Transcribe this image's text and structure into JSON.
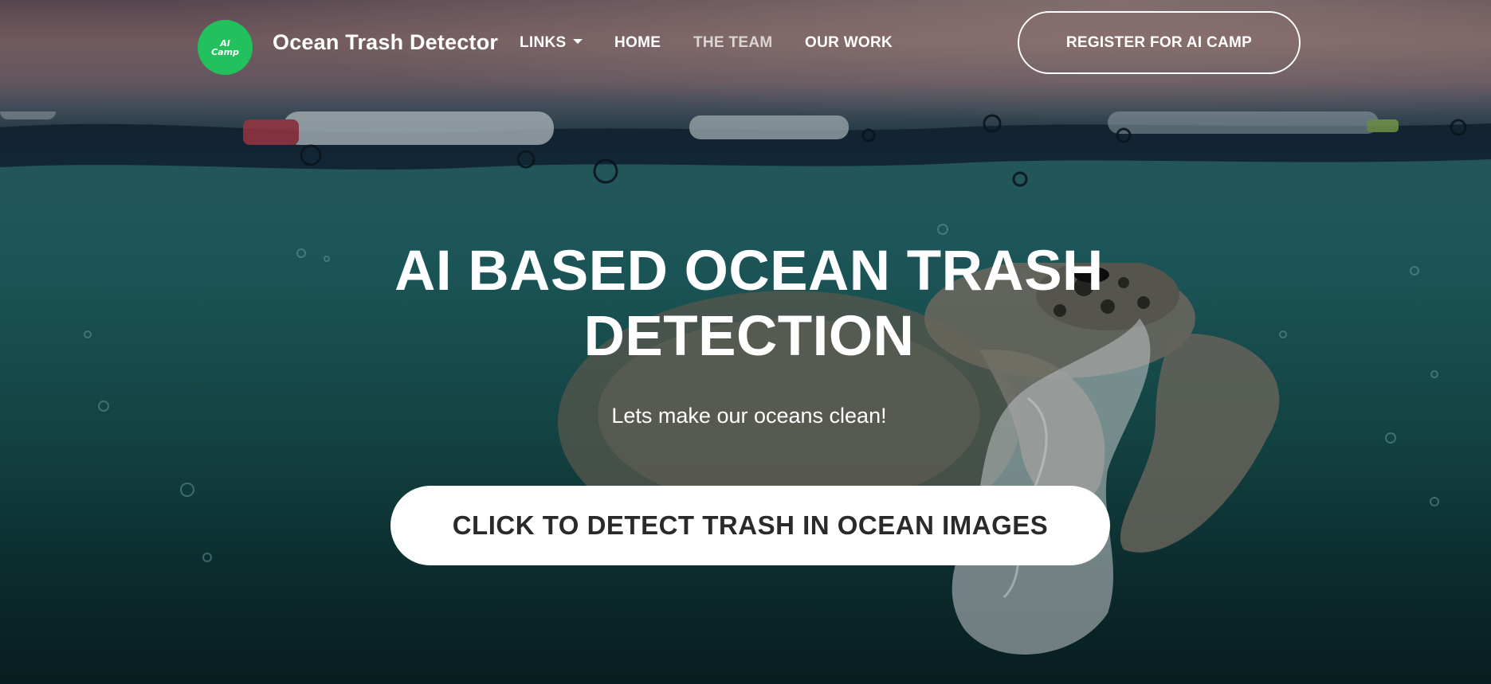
{
  "nav": {
    "logo_text_line1": "AI",
    "logo_text_line2": "Camp",
    "brand": "Ocean Trash Detector",
    "links_label": "LINKS",
    "home_label": "HOME",
    "team_label": "THE TEAM",
    "work_label": "OUR WORK",
    "register_label": "REGISTER FOR AI CAMP"
  },
  "hero": {
    "headline_line1": "AI BASED OCEAN TRASH",
    "headline_line2": "DETECTION",
    "subtitle": "Lets make our oceans clean!",
    "cta_label": "CLICK TO DETECT TRASH IN OCEAN IMAGES"
  },
  "colors": {
    "logo_bg": "#22c15e",
    "cta_bg": "#ffffff",
    "cta_text": "#2a2a2a",
    "text": "#ffffff"
  },
  "icons": [
    "ai-camp-logo-icon",
    "chevron-down-icon"
  ]
}
